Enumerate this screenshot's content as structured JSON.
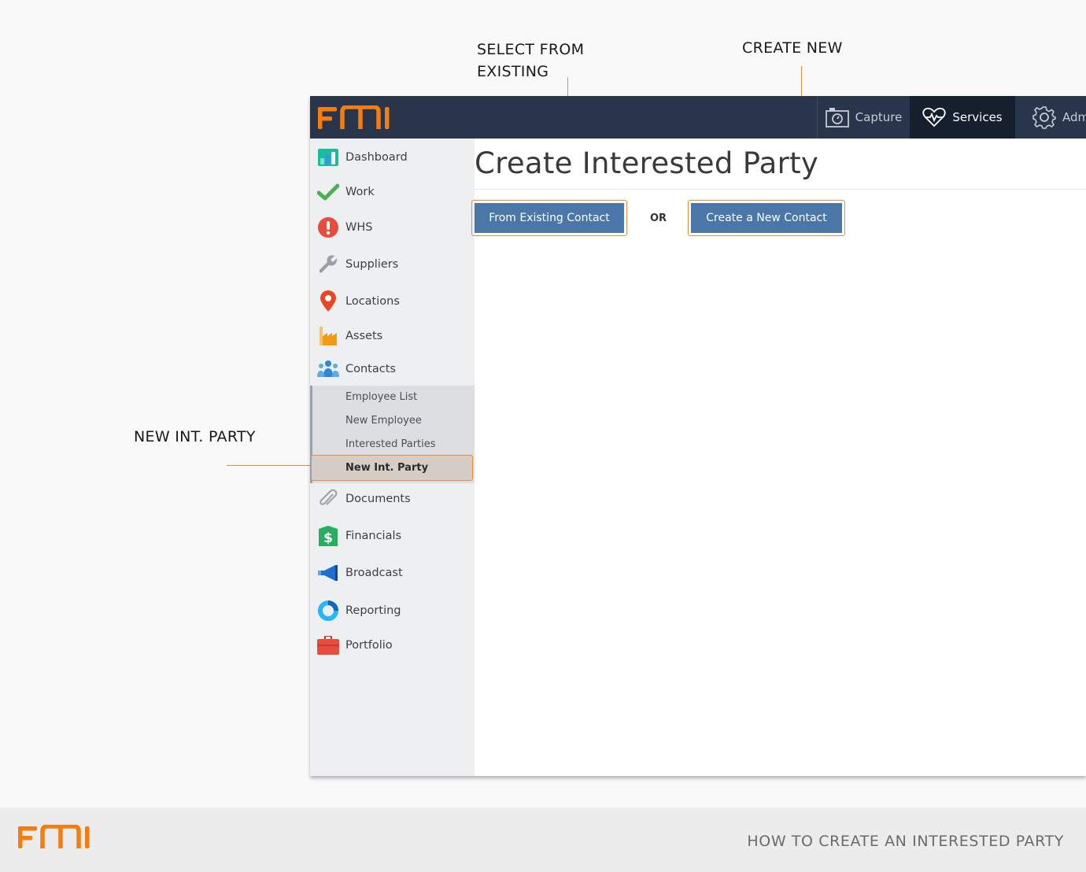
{
  "callouts": {
    "select_existing": "SELECT FROM\nEXISTING",
    "create_new": "CREATE NEW",
    "new_int_party": "NEW INT. PARTY"
  },
  "app": {
    "logo_text": "FMI",
    "topnav": {
      "capture": "Capture",
      "services": "Services",
      "admin": "Adm"
    },
    "sidebar": {
      "items": [
        {
          "label": "Dashboard",
          "icon": "dashboard-icon"
        },
        {
          "label": "Work",
          "icon": "checkmark-icon"
        },
        {
          "label": "WHS",
          "icon": "alert-icon"
        },
        {
          "label": "Suppliers",
          "icon": "wrench-icon"
        },
        {
          "label": "Locations",
          "icon": "map-pin-icon"
        },
        {
          "label": "Assets",
          "icon": "factory-icon"
        },
        {
          "label": "Contacts",
          "icon": "people-icon"
        },
        {
          "label": "Documents",
          "icon": "paperclip-icon"
        },
        {
          "label": "Financials",
          "icon": "dollar-icon"
        },
        {
          "label": "Broadcast",
          "icon": "megaphone-icon"
        },
        {
          "label": "Reporting",
          "icon": "donut-chart-icon"
        },
        {
          "label": "Portfolio",
          "icon": "briefcase-icon"
        }
      ],
      "contacts_sub": [
        "Employee List",
        "New Employee",
        "Interested Parties"
      ],
      "active_sub": "New Int. Party"
    },
    "main": {
      "title": "Create Interested Party",
      "from_existing": "From Existing Contact",
      "or": "OR",
      "create_new": "Create a New Contact"
    }
  },
  "footer": {
    "logo_text": "FMI",
    "caption": "HOW TO CREATE AN INTERESTED PARTY"
  },
  "colors": {
    "accent": "#f08a3c",
    "topbar": "#28354a",
    "button": "#4a77a8"
  }
}
